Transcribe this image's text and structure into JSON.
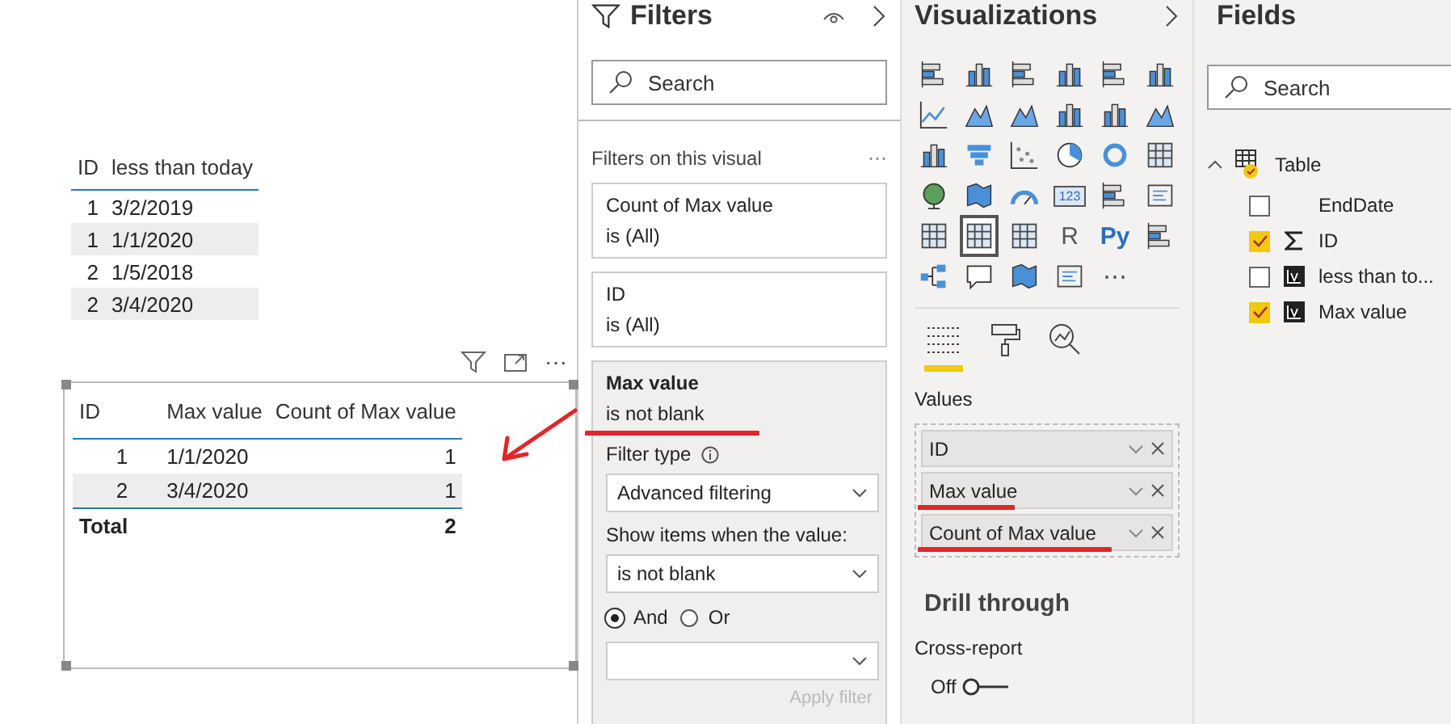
{
  "canvas": {
    "table1": {
      "columns": [
        "ID",
        "less than today"
      ],
      "rows": [
        {
          "cells": [
            "1",
            "3/2/2019"
          ]
        },
        {
          "cells": [
            "1",
            "1/1/2020"
          ]
        },
        {
          "cells": [
            "2",
            "1/5/2018"
          ]
        },
        {
          "cells": [
            "2",
            "3/4/2020"
          ]
        }
      ]
    },
    "visual_more": "⋯",
    "table2": {
      "columns": [
        "ID",
        "Max value",
        "Count of Max value"
      ],
      "rows": [
        {
          "cells": [
            "1",
            "1/1/2020",
            "1"
          ]
        },
        {
          "cells": [
            "2",
            "3/4/2020",
            "1"
          ]
        }
      ],
      "total_label": "Total",
      "total_value": "2"
    },
    "annotation_arrow": true
  },
  "filters": {
    "title": "Filters",
    "search": {
      "placeholder": "Search"
    },
    "section": "Filters on this visual",
    "more": "⋯",
    "cards": [
      {
        "field": "Count of Max value",
        "condition": "is (All)",
        "expanded": false,
        "underlined": false
      },
      {
        "field": "ID",
        "condition": "is (All)",
        "expanded": false,
        "underlined": false
      },
      {
        "field": "Max value",
        "condition": "is not blank",
        "expanded": true,
        "underlined": true
      }
    ],
    "editor": {
      "filter_type_label": "Filter type",
      "filter_type": "Advanced filtering",
      "show_label": "Show items when the value:",
      "operator": "is not blank",
      "logic": [
        {
          "label": "And",
          "selected": true
        },
        {
          "label": "Or",
          "selected": false
        }
      ],
      "apply": "Apply filter",
      "apply_disabled": true
    }
  },
  "visualizations": {
    "title": "Visualizations",
    "icons": [
      {
        "kind": "hbar",
        "selected": false
      },
      {
        "kind": "vbar",
        "selected": false
      },
      {
        "kind": "hbar",
        "selected": false
      },
      {
        "kind": "vbar",
        "selected": false
      },
      {
        "kind": "hbar",
        "selected": false
      },
      {
        "kind": "vbar",
        "selected": false
      },
      {
        "kind": "line",
        "selected": false
      },
      {
        "kind": "area",
        "selected": false
      },
      {
        "kind": "area",
        "selected": false
      },
      {
        "kind": "vbar",
        "selected": false
      },
      {
        "kind": "vbar",
        "selected": false
      },
      {
        "kind": "area",
        "selected": false
      },
      {
        "kind": "vbar",
        "selected": false
      },
      {
        "kind": "funnel",
        "selected": false
      },
      {
        "kind": "scatter",
        "selected": false
      },
      {
        "kind": "pie",
        "selected": false
      },
      {
        "kind": "donut",
        "selected": false
      },
      {
        "kind": "grid",
        "selected": false
      },
      {
        "kind": "globe",
        "selected": false
      },
      {
        "kind": "map",
        "selected": false
      },
      {
        "kind": "gauge",
        "selected": false
      },
      {
        "kind": "card",
        "text": "123",
        "selected": false
      },
      {
        "kind": "hbar",
        "selected": false
      },
      {
        "kind": "card",
        "selected": false
      },
      {
        "kind": "grid",
        "selected": false
      },
      {
        "kind": "grid",
        "selected": true
      },
      {
        "kind": "grid",
        "selected": false
      },
      {
        "kind": "text",
        "text": "R",
        "selected": false
      },
      {
        "kind": "text",
        "text": "Py",
        "selected": false
      },
      {
        "kind": "hbar",
        "selected": false
      },
      {
        "kind": "tree",
        "selected": false
      },
      {
        "kind": "bubble",
        "selected": false
      },
      {
        "kind": "map",
        "selected": false
      },
      {
        "kind": "card",
        "selected": false
      },
      {
        "kind": "text",
        "text": "⋯",
        "selected": false
      }
    ],
    "tabs": [
      {
        "kind": "fields",
        "selected": true
      },
      {
        "kind": "format",
        "selected": false
      },
      {
        "kind": "analytics",
        "selected": false
      }
    ],
    "wells_label": "Values",
    "wells": [
      {
        "label": "ID",
        "underlined": false
      },
      {
        "label": "Max value",
        "underlined": true
      },
      {
        "label": "Count of Max value",
        "underlined": true
      }
    ],
    "drill_title": "Drill through",
    "cross_report": "Cross-report",
    "toggle": {
      "label": "Off",
      "on": false
    }
  },
  "fields": {
    "title": "Fields",
    "search": {
      "placeholder": "Search"
    },
    "tables": [
      {
        "name": "Table",
        "expanded": true,
        "children": [
          {
            "name": "EndDate",
            "checked": false,
            "kind": "column"
          },
          {
            "name": "ID",
            "checked": true,
            "kind": "sum"
          },
          {
            "name": "less than to...",
            "checked": false,
            "kind": "measure"
          },
          {
            "name": "Max value",
            "checked": true,
            "kind": "measure"
          }
        ]
      }
    ]
  }
}
